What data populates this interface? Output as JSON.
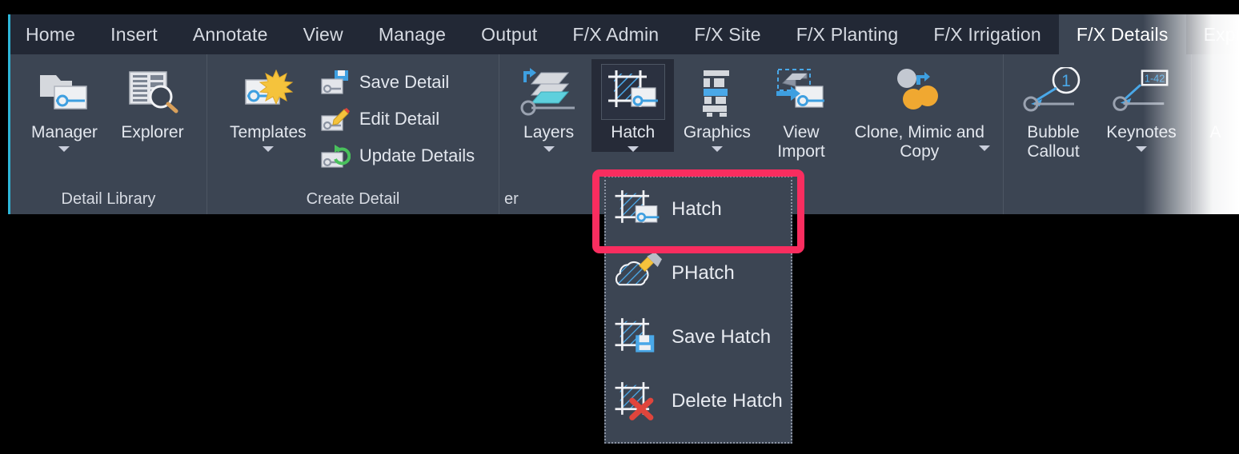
{
  "theme": {
    "tabbar_bg": "#222835",
    "ribbon_bg": "#3c4553",
    "active_tab_bg": "#3c4553",
    "text": "#d6dae2",
    "accent_left": "#2fb6d8",
    "highlight_pink": "#f92d5f",
    "icon_blue": "#3e9fe0",
    "icon_cyan": "#5ed0dd",
    "icon_orange": "#f0a831",
    "icon_green": "#49c15c",
    "icon_red": "#e0453c",
    "icon_grey": "#d5d8dd"
  },
  "tabs": [
    {
      "label": "Home",
      "active": false
    },
    {
      "label": "Insert",
      "active": false
    },
    {
      "label": "Annotate",
      "active": false
    },
    {
      "label": "View",
      "active": false
    },
    {
      "label": "Manage",
      "active": false
    },
    {
      "label": "Output",
      "active": false
    },
    {
      "label": "F/X Admin",
      "active": false
    },
    {
      "label": "F/X Site",
      "active": false
    },
    {
      "label": "F/X Planting",
      "active": false
    },
    {
      "label": "F/X Irrigation",
      "active": false
    },
    {
      "label": "F/X Details",
      "active": true
    },
    {
      "label": "Expre",
      "active": false
    }
  ],
  "panels": [
    {
      "label": "Detail Library",
      "buttons": [
        {
          "name": "manager",
          "label": "Manager",
          "icon": "folder-detail-icon",
          "caret": true
        },
        {
          "name": "explorer",
          "label": "Explorer",
          "icon": "list-search-icon",
          "caret": false
        }
      ]
    },
    {
      "label": "Create Detail",
      "buttons": [
        {
          "name": "templates",
          "label": "Templates",
          "icon": "detail-star-icon",
          "caret": true
        }
      ],
      "small_buttons": [
        {
          "name": "save-detail",
          "label": "Save Detail",
          "icon": "save-detail-icon"
        },
        {
          "name": "edit-detail",
          "label": "Edit Detail",
          "icon": "edit-detail-icon"
        },
        {
          "name": "update-details",
          "label": "Update Details",
          "icon": "update-details-icon"
        }
      ]
    },
    {
      "label": "er",
      "label_truncated": true,
      "buttons": [
        {
          "name": "layers",
          "label": "Layers",
          "icon": "layers-icon",
          "caret": true
        },
        {
          "name": "hatch",
          "label": "Hatch",
          "icon": "hatch-icon",
          "caret": true,
          "active": true
        },
        {
          "name": "graphics",
          "label": "Graphics",
          "icon": "graphics-icon",
          "caret": true
        },
        {
          "name": "view-import",
          "label": "View Import",
          "icon": "view-import-icon",
          "caret": false
        },
        {
          "name": "clone-mimic-copy",
          "label": "Clone, Mimic and Copy",
          "icon": "clone-mimic-icon",
          "caret": true,
          "caret_side": true
        }
      ]
    },
    {
      "label": "",
      "buttons": [
        {
          "name": "bubble-callout",
          "label": "Bubble Callout",
          "icon": "bubble-callout-icon",
          "caret": false
        },
        {
          "name": "keynotes",
          "label": "Keynotes",
          "icon": "keynotes-icon",
          "caret": true,
          "badge": "1-42"
        }
      ]
    },
    {
      "label": "",
      "buttons": [
        {
          "name": "annotate-truncated",
          "label": "A",
          "icon": "partial-icon",
          "caret": false
        }
      ]
    }
  ],
  "dropdown": {
    "name": "hatch-dropdown-menu",
    "items": [
      {
        "name": "hatch",
        "label": "Hatch",
        "icon": "hatch-icon",
        "highlighted": true
      },
      {
        "name": "phatch",
        "label": "PHatch",
        "icon": "phatch-cloud-brush-icon",
        "highlighted": false
      },
      {
        "name": "save-hatch",
        "label": "Save Hatch",
        "icon": "save-hatch-icon",
        "highlighted": false
      },
      {
        "name": "delete-hatch",
        "label": "Delete Hatch",
        "icon": "delete-hatch-icon",
        "highlighted": false
      }
    ]
  },
  "keynotes_badge": "1-42",
  "bubble_badge": "1"
}
